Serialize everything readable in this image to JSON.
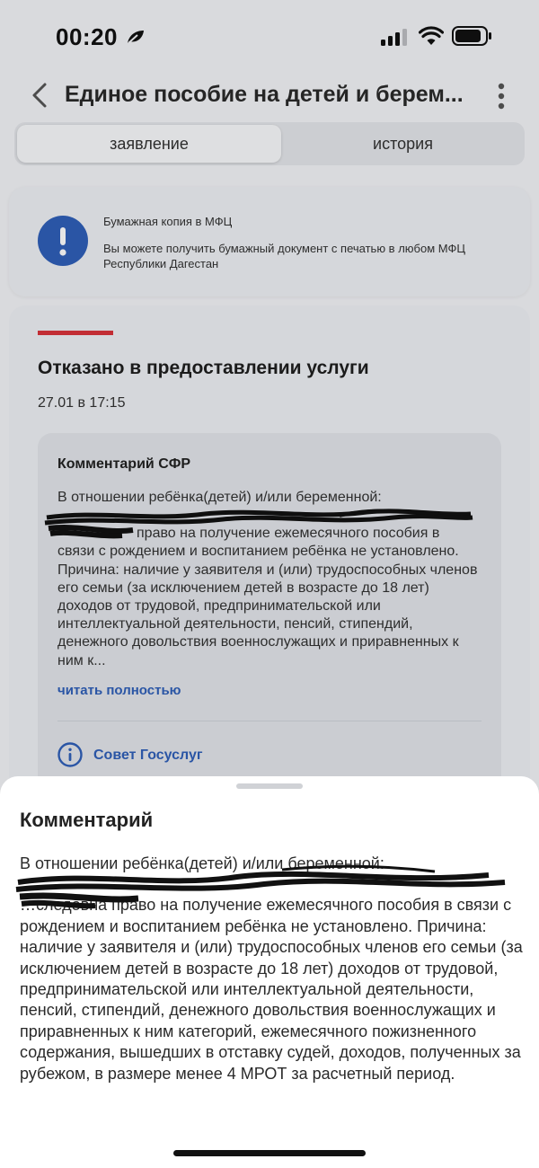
{
  "status_bar": {
    "time": "00:20"
  },
  "header": {
    "title": "Единое пособие на детей и берем..."
  },
  "tabs": [
    {
      "label": "заявление",
      "active": true
    },
    {
      "label": "история",
      "active": false
    }
  ],
  "info": {
    "title": "Бумажная копия в МФЦ",
    "text": "Вы можете получить бумажный документ с печатью в любом МФЦ Республики Дагестан",
    "icon": "exclamation-icon"
  },
  "result": {
    "status": "Отказано в предоставлении услуги",
    "date": "27.01 в 17:15",
    "accent": "#d9333a"
  },
  "comment": {
    "title": "Комментарий СФР",
    "first_line": "В отношении ребёнка(детей) и/или беременной:",
    "text": "пра­во на получение ежемесячного пособия в связи с рождением и воспитанием ребёнка не установлено. Причина: наличие у заявителя и (или) трудоспособных членов его семьи (за исключением детей в возрасте до 18 лет) доходов от трудовой, предпринимательской или интеллектуальной деятельности, пенсий, стипендий, денежного довольствия военнослужащих и приравненных к ним к...",
    "read_more": "читать полностью",
    "advice": "Совет Госуслуг"
  },
  "sheet": {
    "title": "Комментарий",
    "first_line": "В отношении ребёнка(детей) и/или беременной:",
    "text": "…следовна право на получение ежемесячного пособия в связи с рождением и воспитанием ребёнка не установлено. Причина: наличие у заявителя и (или) трудоспособных членов его семьи (за исключением детей в возрасте до 18 лет) доходов от трудовой, предпринимательской или интеллектуальной деятельности, пенсий, стипендий, денежного довольствия военнослужащих и приравненных к ним категорий, ежемесячного пожизненного содержания, вышедших в отставку судей, доходов, полученных за рубежом, в размере менее 4 МРОТ за расчетный период."
  },
  "colors": {
    "link": "#2f5fb8",
    "accent_red": "#d9333a"
  }
}
